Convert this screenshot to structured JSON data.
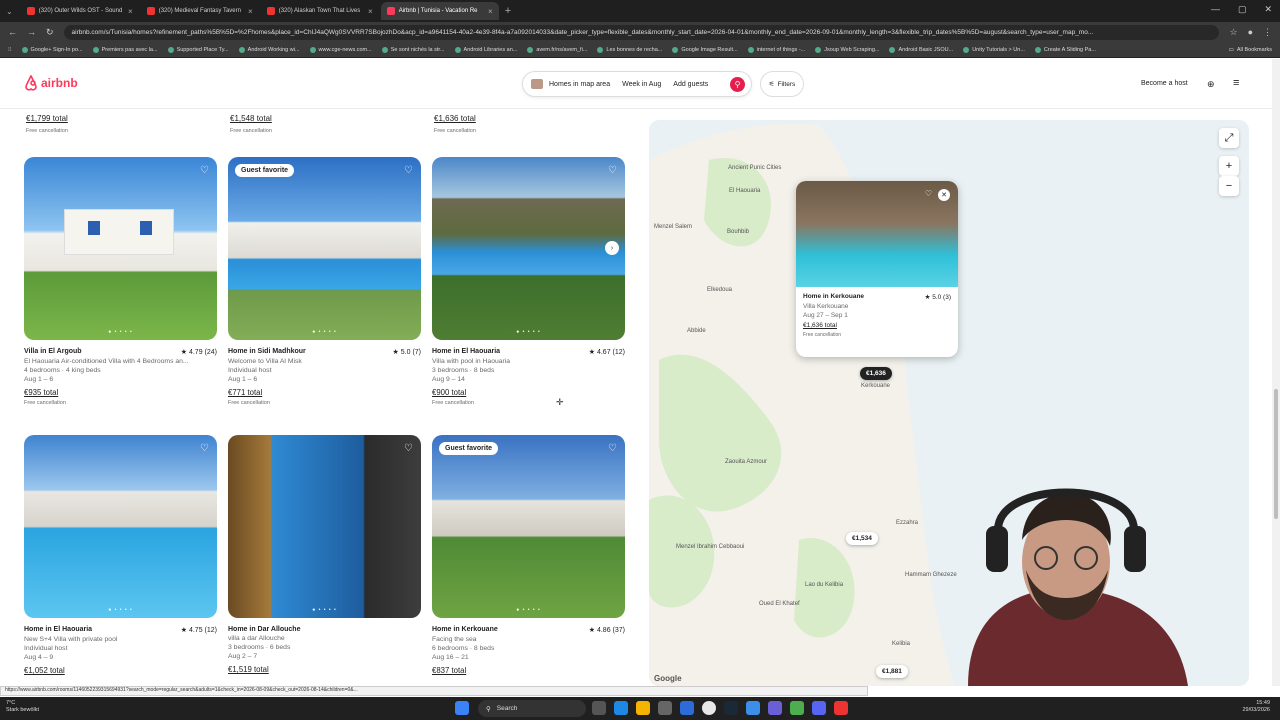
{
  "browser": {
    "tabs": [
      {
        "title": "(320) Outer Wilds OST - Sound"
      },
      {
        "title": "(320) Medieval Fantasy Tavern"
      },
      {
        "title": "(320) Alaskan Town That Lives"
      },
      {
        "title": "Airbnb | Tunisia - Vacation Re"
      }
    ],
    "url": "airbnb.com/s/Tunisia/homes?refinement_paths%5B%5D=%2Fhomes&place_id=ChIJ4aQWg0SVVRR7SBojozhDo&acp_id=a9641154-40a2-4e39-8f4a-a7a092014033&date_picker_type=flexible_dates&monthly_start_date=2026-04-01&monthly_end_date=2026-09-01&monthly_length=3&flexible_trip_dates%5B%5D=august&search_type=user_map_mo...",
    "bookmarks": [
      "Google+ Sign-In po...",
      "Premiers pas avec la...",
      "Supported Place Ty...",
      "Android Working wi...",
      "www.cge-news.com...",
      "Se sont nichés la str...",
      "Android Libraries an...",
      "avem.fr/ns/avem_fi...",
      "Les bonnes de recha...",
      "Google Image Result...",
      "internet of things -...",
      "Jsoup Web Scraping...",
      "Android Basic JSOU...",
      "Unity Tutorials > Un...",
      "Create A Sliding Pa..."
    ],
    "all_bookmarks": "All Bookmarks"
  },
  "header": {
    "logo_text": "airbnb",
    "search_area": "Homes in map area",
    "search_dates": "Week in Aug",
    "search_guests": "Add guests",
    "filters": "Filters",
    "become_host": "Become a host"
  },
  "top_row": [
    {
      "price": "€1,799 total",
      "note": "Free cancellation"
    },
    {
      "price": "€1,548 total",
      "note": "Free cancellation"
    },
    {
      "price": "€1,636 total",
      "note": "Free cancellation"
    }
  ],
  "listings": [
    {
      "title": "Villa in El Argoub",
      "rating": "★ 4.79 (24)",
      "line1": "El Haouaria Air-conditioned Villa with 4 Bedrooms an...",
      "line2": "4 bedrooms · 4 king beds",
      "dates": "Aug 1 – 6",
      "price": "€935 total",
      "note": "Free cancellation",
      "badge": ""
    },
    {
      "title": "Home in Sidi Madhkour",
      "rating": "★ 5.0 (7)",
      "line1": "Welcome to Villa Al Misk",
      "line2": "Individual host",
      "dates": "Aug 1 – 6",
      "price": "€771 total",
      "note": "Free cancellation",
      "badge": "Guest favorite"
    },
    {
      "title": "Home in El Haouaria",
      "rating": "★ 4.67 (12)",
      "line1": "Villa with pool in Haouaria",
      "line2": "3 bedrooms · 8 beds",
      "dates": "Aug 9 – 14",
      "price": "€900 total",
      "note": "Free cancellation",
      "badge": ""
    },
    {
      "title": "Home in El Haouaria",
      "rating": "★ 4.75 (12)",
      "line1": "New S+4 Villa with private pool",
      "line2": "Individual host",
      "dates": "Aug 4 – 9",
      "price": "€1,052 total",
      "note": "",
      "badge": ""
    },
    {
      "title": "Home in Dar Allouche",
      "rating": "",
      "line1": "villa a dar Allouche",
      "line2": "3 bedrooms · 6 beds",
      "dates": "Aug 2 – 7",
      "price": "€1,519 total",
      "note": "",
      "badge": ""
    },
    {
      "title": "Home in Kerkouane",
      "rating": "★ 4.86 (37)",
      "line1": "Facing the sea",
      "line2": "6 bedrooms · 8 beds",
      "dates": "Aug 16 – 21",
      "price": "€837 total",
      "note": "",
      "badge": "Guest favorite"
    }
  ],
  "map": {
    "places": [
      "El Haouaria",
      "Menzel Salem",
      "Bouhbib",
      "Elkedoua",
      "Abbide",
      "Kerkouane",
      "Zaouita Azmour",
      "Ezzahra",
      "Menzel Ibrahim Cebbaoui",
      "Hammam Ghezeze",
      "Oued El Khatef",
      "Lao du Kelibia",
      "Kelibia",
      "Ancient Punic Cities"
    ],
    "pins": [
      "€1,636",
      "€1,534",
      "€1,881"
    ],
    "popup": {
      "title": "Home in Kerkouane",
      "rating": "★ 5.0 (3)",
      "name": "Villa Kerkouane",
      "dates": "Aug 27 – Sep 1",
      "price": "€1,636 total",
      "note": "Free cancellation"
    },
    "google": "Google"
  },
  "status_url": "https://www.airbnb.com/rooms/1146052239315694931?search_mode=regular_search&adults=1&check_in=2026-08-09&check_out=2026-08-14&children=0&...",
  "taskbar": {
    "weather_temp": "7°C",
    "weather_desc": "Stark bewölkt",
    "search": "Search",
    "time": "15:49",
    "date": "29/03/2026"
  },
  "colors": {
    "brand": "#ff385c",
    "search_button": "#e61e4d"
  }
}
